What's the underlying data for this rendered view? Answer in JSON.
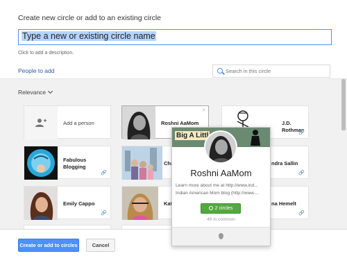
{
  "dialog": {
    "title": "Create new circle or add to an existing circle",
    "name_input_value": "Type a new or existing circle name",
    "description_hint": "Click to add a description.",
    "tab_label": "People to add",
    "search_placeholder": "Search in this circle",
    "sort_label": "Relevance",
    "accent_color": "#4d90fe"
  },
  "people": {
    "add_person": "Add a person",
    "roshni": "Roshni AaMom",
    "jd": "J.D. Rothman",
    "fabulous_1": "Fabulous",
    "fabulous_2": "Blogging",
    "chr": "Chr",
    "sallin": "ndra Sallin",
    "emily": "Emily Cappo",
    "kat": "Kat",
    "hemelt": "na Hemelt"
  },
  "hovercard": {
    "banner_text": "Big A Littl",
    "name": "Roshni AaMom",
    "bio_line1": "Learn more about me at http://www.ind...",
    "bio_line2": "Indian American Mom blog (http://www....",
    "circles_button": "2 circles",
    "in_common": "49 in common",
    "button_color": "#53a93f"
  },
  "buttons": {
    "create": "Create or add to circles",
    "cancel": "Cancel"
  },
  "icons": {
    "search": "search-icon",
    "close": "close-icon",
    "link": "link-icon",
    "add_person": "add-person-icon",
    "dropdown": "chevron-down-icon",
    "location": "location-pin-icon"
  }
}
